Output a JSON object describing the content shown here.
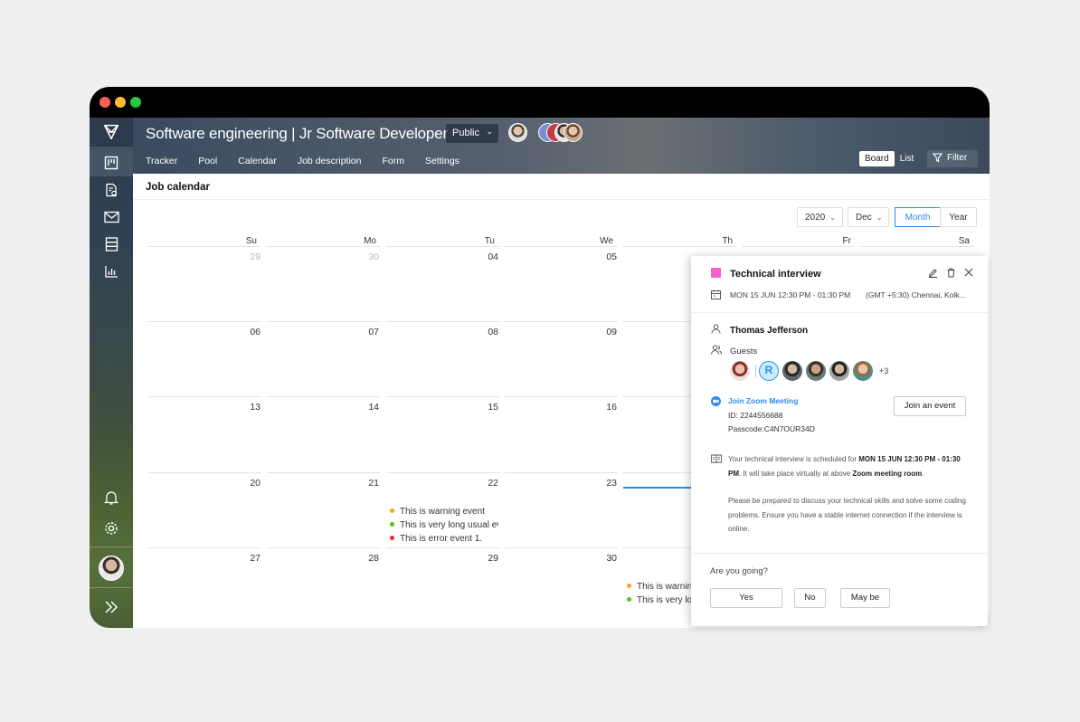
{
  "header": {
    "title": "Software engineering | Jr Software Developer",
    "visibility": "Public",
    "tabs": [
      "Tracker",
      "Pool",
      "Calendar",
      "Job description",
      "Form",
      "Settings"
    ],
    "view_board": "Board",
    "view_list": "List",
    "filter": "Filter"
  },
  "main": {
    "title": "Job calendar",
    "year": "2020",
    "month": "Dec",
    "mode_month": "Month",
    "mode_year": "Year",
    "weekdays": [
      "Su",
      "Mo",
      "Tu",
      "We",
      "Th",
      "Fr",
      "Sa"
    ],
    "weeks": [
      [
        "29",
        "30",
        "04",
        "05",
        "",
        "",
        ""
      ],
      [
        "06",
        "07",
        "08",
        "09",
        "",
        "",
        ""
      ],
      [
        "13",
        "14",
        "15",
        "16",
        "",
        "",
        ""
      ],
      [
        "20",
        "21",
        "22",
        "23",
        "",
        "",
        ""
      ],
      [
        "27",
        "28",
        "29",
        "30",
        "",
        "",
        ""
      ]
    ],
    "events_tu15": [
      {
        "text": "This is warning event",
        "color": "#f5a623"
      },
      {
        "text": "This is very long usual event",
        "color": "#52c41a"
      },
      {
        "text": "This is error event 1.",
        "color": "#f5222d"
      }
    ],
    "events_th23": [
      {
        "text": "This is warning event",
        "color": "#f5a623"
      },
      {
        "text": "This is very long usual event",
        "color": "#52c41a"
      }
    ]
  },
  "popup": {
    "title": "Technical interview",
    "datetime": "MON 15 JUN 12:30 PM - 01:30 PM",
    "timezone": "(GMT +5:30) Chennai, Kolk...",
    "organizer": "Thomas Jefferson",
    "guests_label": "Guests",
    "guest_r": "R",
    "guests_more": "+3",
    "zoom_link": "Join Zoom Meeting",
    "zoom_id": "ID: 2244556688",
    "zoom_passcode": "Passcode:C4N7OUR34D",
    "join_button": "Join an event",
    "desc_1a": "Your technical interview is scheduled for ",
    "desc_1b": "MON 15 JUN 12:30 PM - 01:30 PM",
    "desc_1c": ". It will take place virtually at above ",
    "desc_1d": "Zoom meeting room",
    "desc_1e": ".",
    "desc_2": "Please be prepared to discuss your technical skills and solve some coding problems. Ensure you have a stable internet connection if the interview is online.",
    "going": "Are you going?",
    "yes": "Yes",
    "no": "No",
    "maybe": "May be"
  },
  "colors": {
    "accent": "#2d8cf0",
    "event_swatch": "#f55ecb"
  }
}
